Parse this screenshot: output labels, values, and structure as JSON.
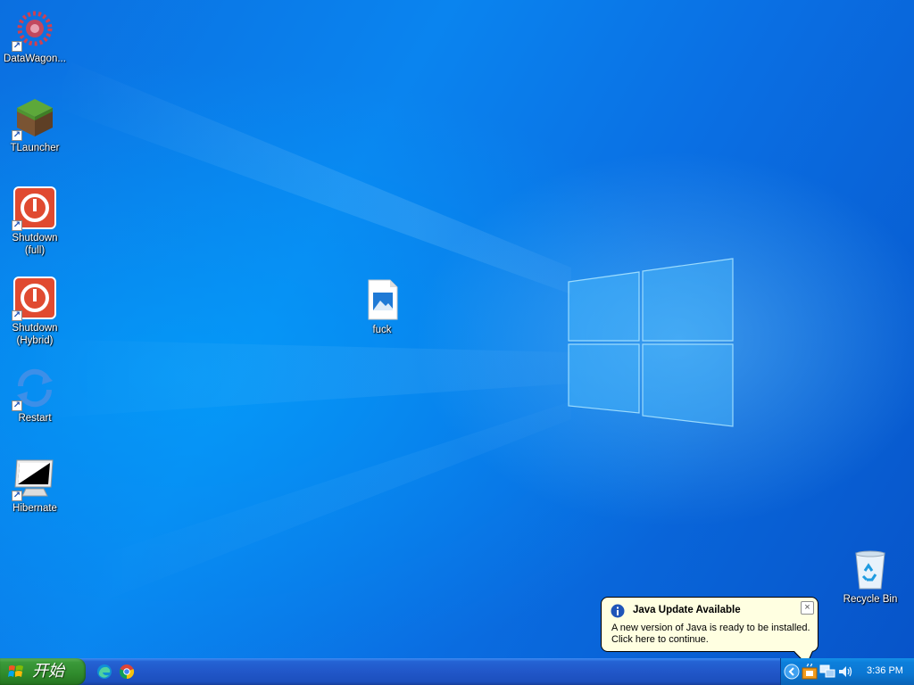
{
  "desktop": {
    "icons": [
      {
        "label": "DataWagon...",
        "icon": "datawagon-gear-icon"
      },
      {
        "label": "TLauncher",
        "icon": "minecraft-grass-block-icon"
      },
      {
        "label": "Shutdown\n(full)",
        "icon": "power-icon"
      },
      {
        "label": "Shutdown\n(Hybrid)",
        "icon": "power-icon"
      },
      {
        "label": "Restart",
        "icon": "restart-arrows-icon"
      },
      {
        "label": "Hibernate",
        "icon": "monitor-icon"
      },
      {
        "label": "fuck",
        "icon": "image-file-icon"
      },
      {
        "label": "Recycle Bin",
        "icon": "recycle-bin-icon"
      }
    ]
  },
  "taskbar": {
    "start_label": "开始",
    "quick_launch": [
      "edge-icon",
      "chrome-icon"
    ],
    "tray": {
      "icons": [
        "show-hidden-chevron-icon",
        "java-update-icon",
        "network-icon",
        "volume-icon"
      ],
      "clock": "3:36 PM"
    }
  },
  "balloon": {
    "title": "Java Update Available",
    "body_line1": "A new version of Java is ready to be installed.",
    "body_line2": "Click here to continue.",
    "close": "×"
  },
  "colors": {
    "taskbar_blue": "#2157c9",
    "start_green": "#3b9a3a",
    "tray_blue": "#0b76d2",
    "balloon_bg": "#ffffe1"
  }
}
